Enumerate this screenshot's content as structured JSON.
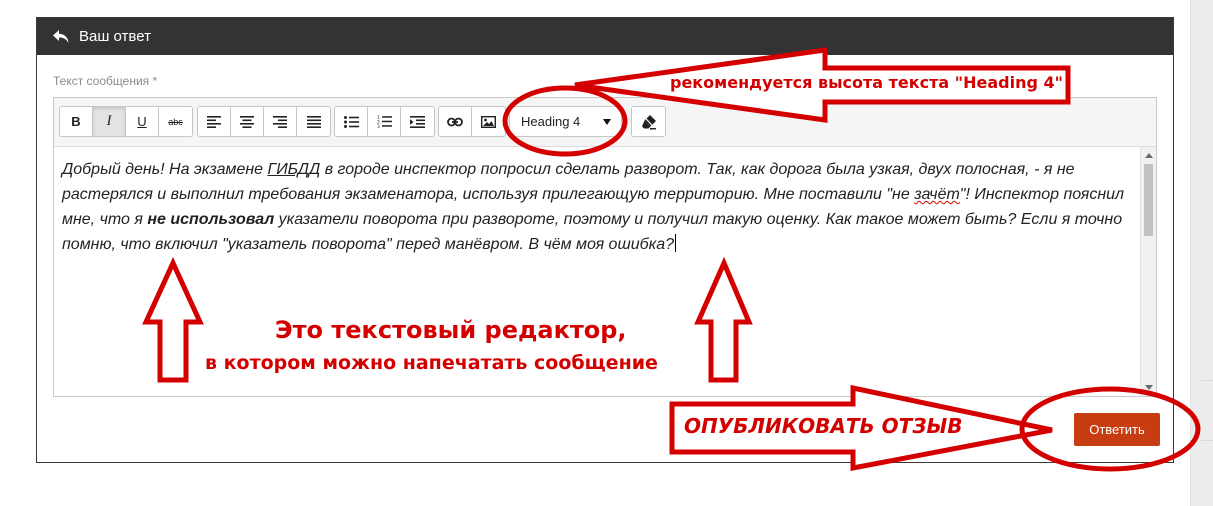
{
  "panel": {
    "title": "Ваш ответ",
    "field_label": "Текст сообщения *"
  },
  "toolbar": {
    "bold_label": "B",
    "italic_label": "I",
    "underline_label": "U",
    "strike_label": "abc",
    "heading_select_value": "Heading 4"
  },
  "editor": {
    "text_1": " Добрый день! На экзамене ",
    "text_2": "ГИБДД",
    "text_3": " в городе инспектор попросил сделать разворот. Так, как дорога была узкая, двух полосная, - я не растерялся и выполнил требования экзаменатора, используя прилегающую территорию. Мне поставили \"не ",
    "text_4": "зачёт",
    "text_5": "\"! Инспектор пояснил мне, что я ",
    "text_6": "не использовал",
    "text_7": " указатели поворота при развороте, поэтому и получил такую оценку. Как такое может быть? Если я точно помню, что включил \"указатель поворота\" перед манёвром. В чём моя ошибка?"
  },
  "submit": {
    "label": "Ответить"
  },
  "annotations": {
    "heading_note": "рекомендуется высота текста \"Heading 4\"",
    "editor_note_line1": "Это текстовый редактор,",
    "editor_note_line2": "в котором можно напечатать сообщение",
    "publish_note": "ОПУБЛИКОВАТЬ ОТЗЫВ"
  },
  "colors": {
    "annotation": "#d40000",
    "header_bg": "#333333",
    "submit_bg": "#c83c12"
  }
}
